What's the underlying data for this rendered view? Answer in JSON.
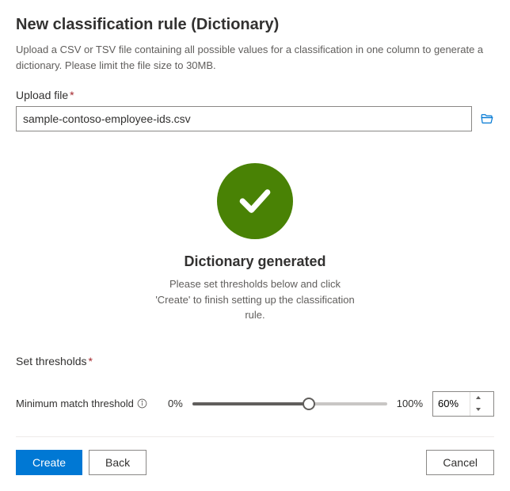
{
  "page": {
    "title": "New classification rule (Dictionary)",
    "description": "Upload a CSV or TSV file containing all possible values for a classification in one column to generate a dictionary. Please limit the file size to 30MB."
  },
  "upload": {
    "label": "Upload file",
    "value": "sample-contoso-employee-ids.csv"
  },
  "status": {
    "title": "Dictionary generated",
    "description": "Please set thresholds below and click 'Create' to finish setting up the classification rule."
  },
  "thresholds": {
    "heading": "Set thresholds",
    "min_match": {
      "label": "Minimum match threshold",
      "min_display": "0%",
      "max_display": "100%",
      "value_display": "60%",
      "value_percent": 60
    }
  },
  "footer": {
    "create": "Create",
    "back": "Back",
    "cancel": "Cancel"
  }
}
